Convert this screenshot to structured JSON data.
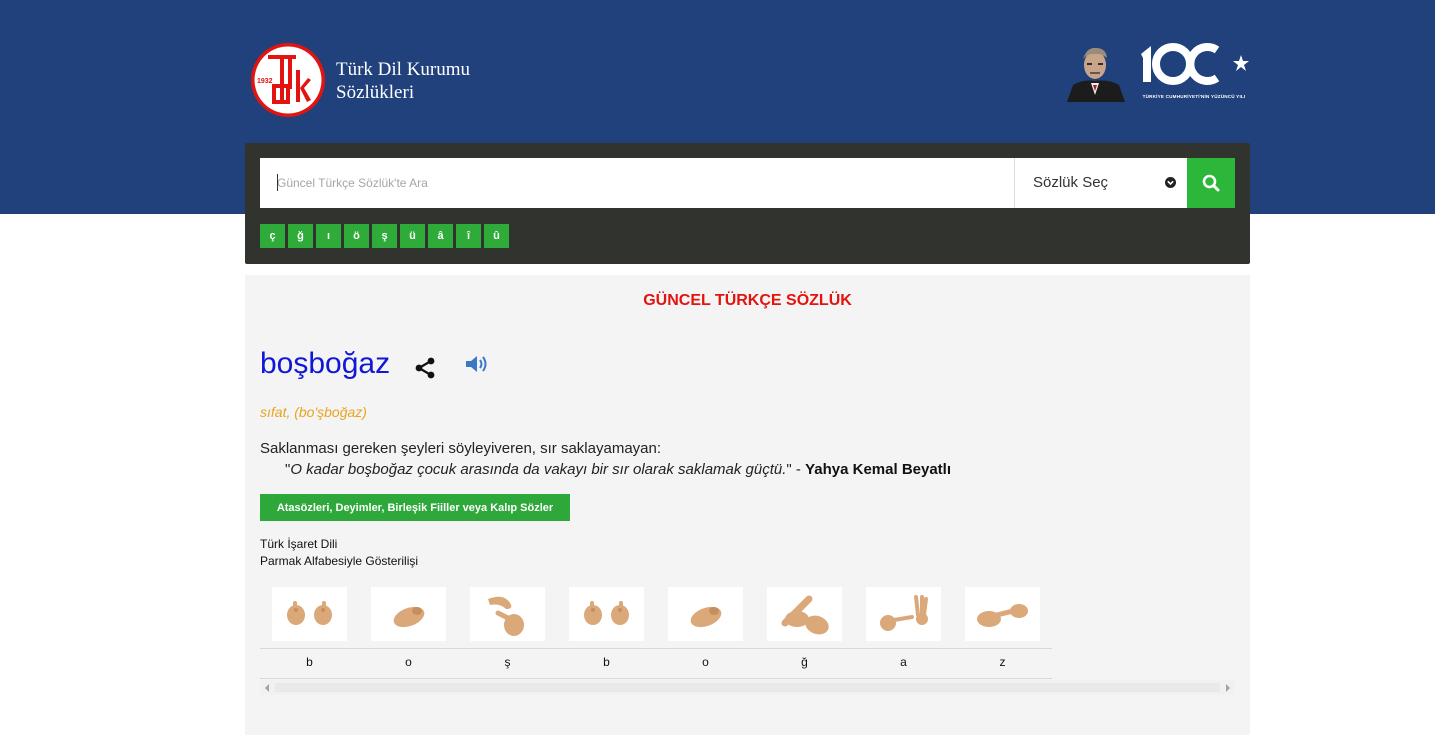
{
  "header": {
    "brand_line1": "Türk Dil Kurumu",
    "brand_line2": "Sözlükleri",
    "logo_year": "1932",
    "centennial_caption": "TÜRKİYE CUMHURİYETİ'NİN YÜZÜNCÜ YILI",
    "colors": {
      "band": "#20417c",
      "logo_red": "#e3140f"
    }
  },
  "search": {
    "placeholder": "Güncel Türkçe Sözlük'te Ara",
    "value": "",
    "select_label": "Sözlük Seç",
    "button_icon": "search-icon",
    "special_chars": [
      "ç",
      "ğ",
      "ı",
      "ö",
      "ş",
      "ü",
      "â",
      "î",
      "û"
    ],
    "colors": {
      "button": "#2cb73a",
      "panel": "#31332f"
    }
  },
  "entry": {
    "dictionary_title": "GÜNCEL TÜRKÇE SÖZLÜK",
    "word": "boşboğaz",
    "share_icon": "share-icon",
    "sound_icon": "speaker-icon",
    "word_type": "sıfat, (bo'şboğaz)",
    "meaning": "Saklanması gereken şeyleri söyleyiveren, sır saklayamayan:",
    "example_open": "\"",
    "example_quote": "O kadar boşboğaz çocuk arasında da vakayı bir sır olarak saklamak güçtü.",
    "example_close": "\"",
    "example_sep": " - ",
    "example_author": "Yahya Kemal Beyatlı",
    "idioms_button": "Atasözleri, Deyimler, Birleşik Fiiller veya Kalıp Sözler",
    "sign_language_title": "Türk İşaret Dili",
    "sign_language_subtitle": "Parmak Alfabesiyle Gösterilişi",
    "sign_letters": [
      "b",
      "o",
      "ş",
      "b",
      "o",
      "ğ",
      "a",
      "z"
    ],
    "colors": {
      "word": "#1017d6",
      "title": "#e3140f",
      "word_type": "#e8a320"
    }
  }
}
